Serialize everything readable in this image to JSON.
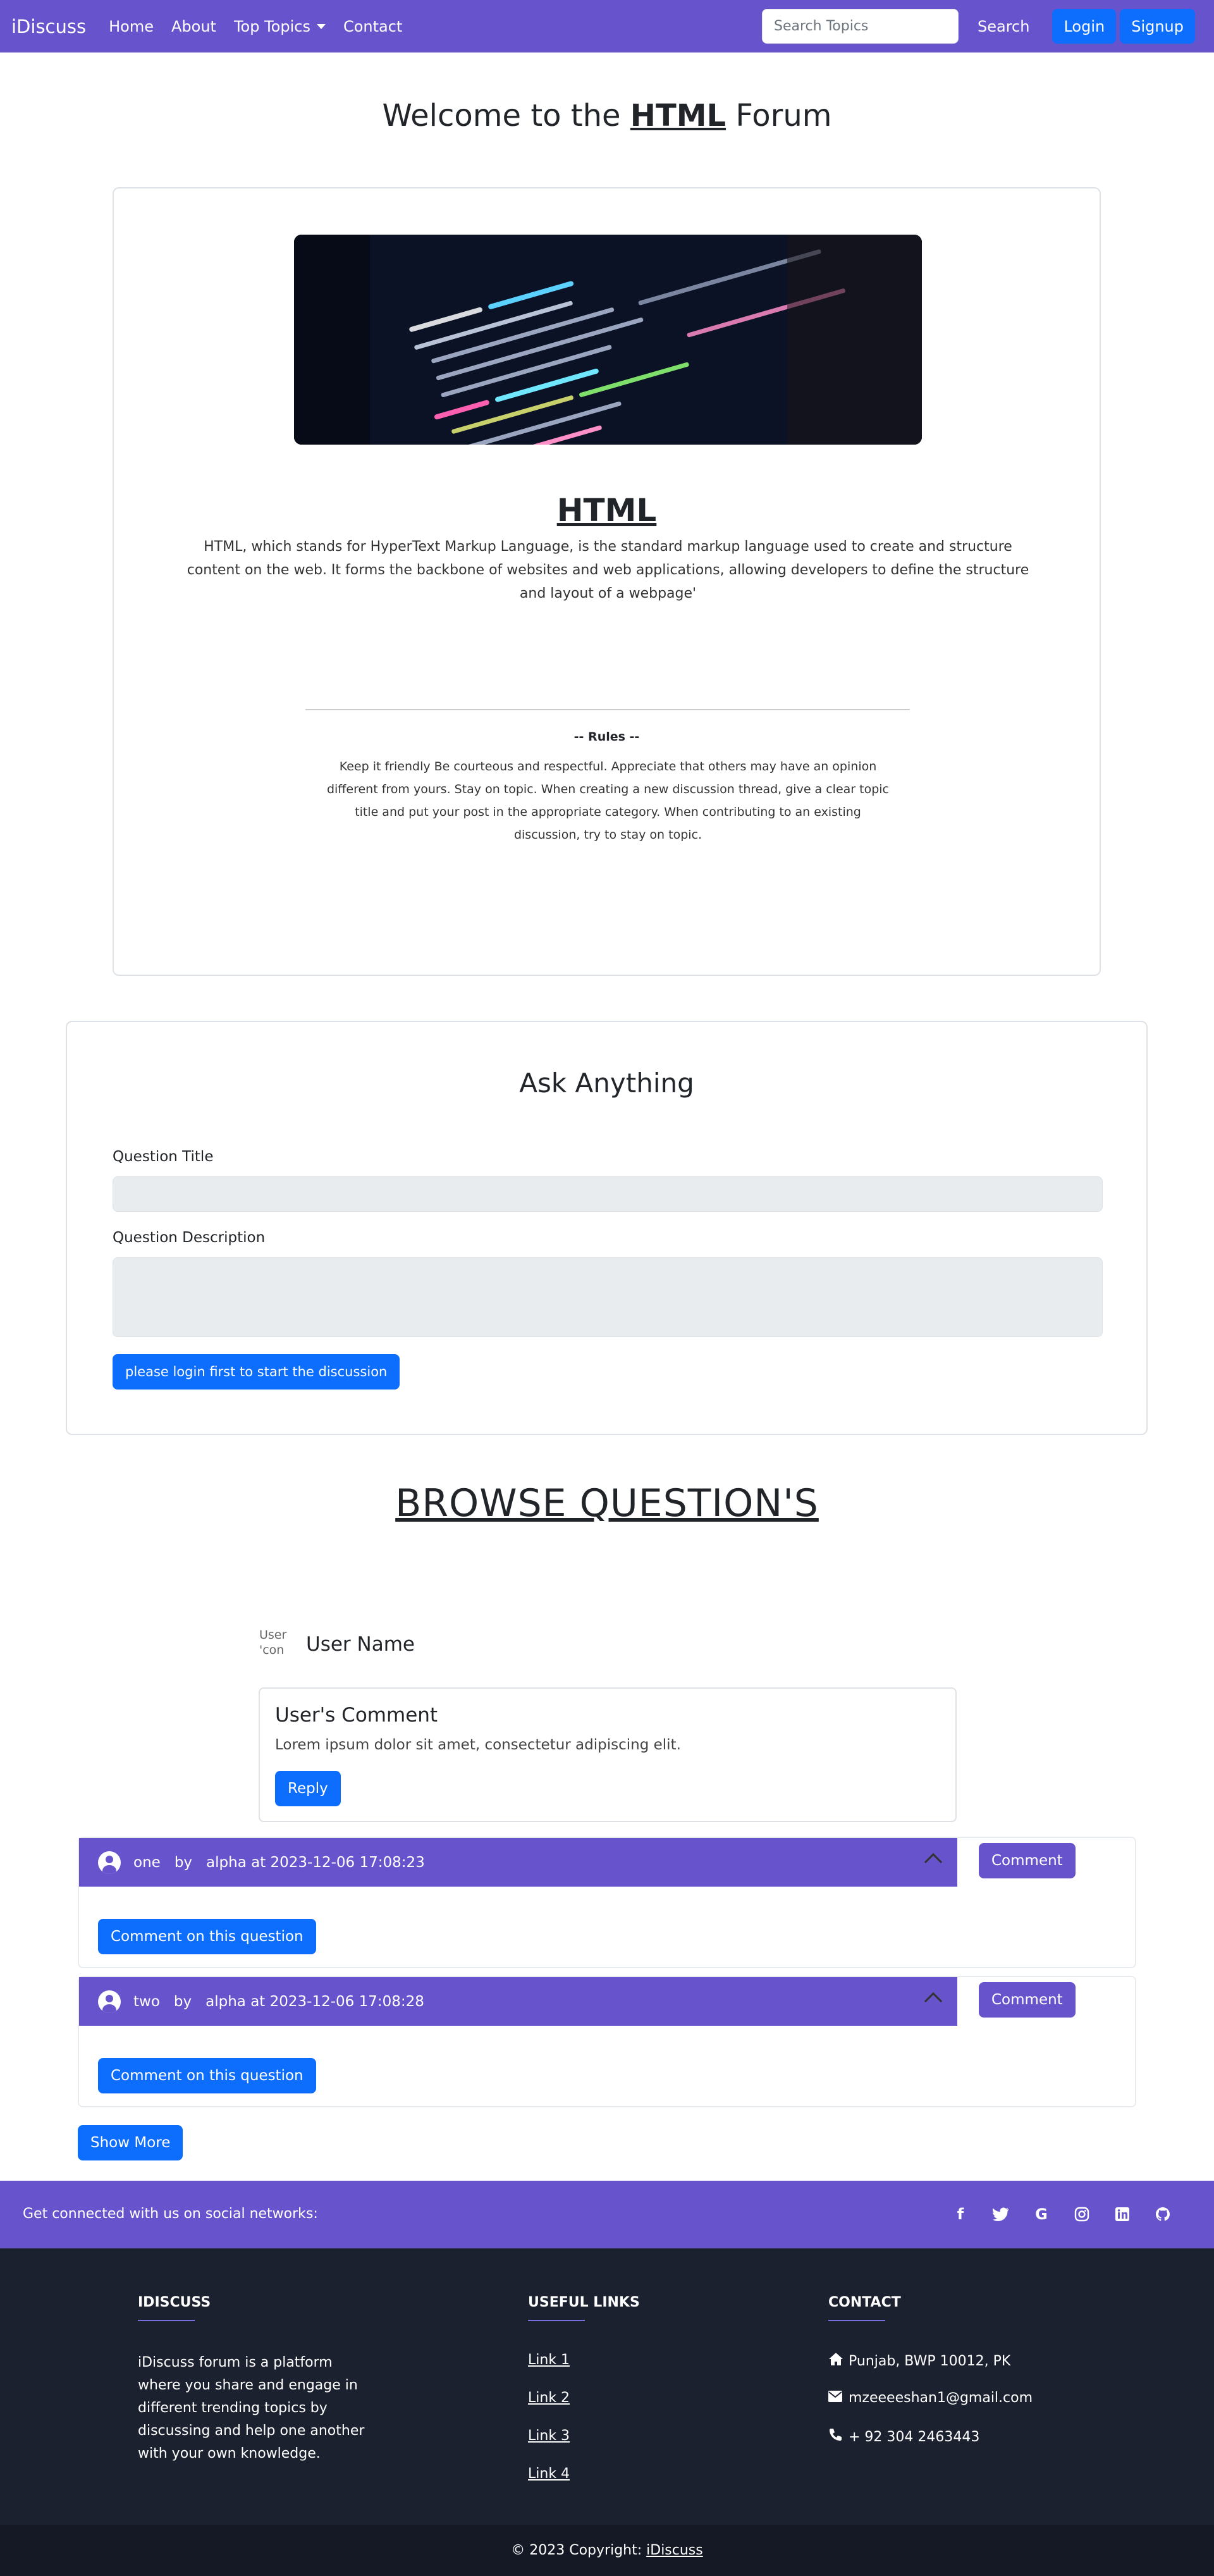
{
  "nav": {
    "brand": "iDiscuss",
    "links": [
      "Home",
      "About",
      "Top Topics",
      "Contact"
    ],
    "search_placeholder": "Search Topics",
    "search_label": "Search",
    "login_label": "Login",
    "signup_label": "Signup"
  },
  "page": {
    "title_prefix": "Welcome to the ",
    "title_topic": "HTML",
    "title_suffix": " Forum"
  },
  "category": {
    "name": "HTML",
    "description": "HTML, which stands for HyperText Markup Language, is the standard markup language used to create and structure content on the web. It forms the backbone of websites and web applications, allowing developers to define the structure and layout of a webpage'",
    "rules_title": "-- Rules --",
    "rules_text": "Keep it friendly Be courteous and respectful. Appreciate that others may have an opinion different from yours. Stay on topic. When creating a new discussion thread, give a clear topic title and put your post in the appropriate category. When contributing to an existing discussion, try to stay on topic."
  },
  "ask": {
    "title": "Ask Anything",
    "question_title_label": "Question Title",
    "question_title_value": "",
    "question_desc_label": "Question Description",
    "question_desc_value": "",
    "login_prompt": "please login first to start the discussion"
  },
  "browse": {
    "title": "BROWSE QUESTION'S",
    "sample_user": {
      "avatar_alt": "User 'con",
      "name": "User Name",
      "comment_title": "User's Comment",
      "comment_text": "Lorem ipsum dolor sit amet, consectetur adipiscing elit.",
      "reply_label": "Reply"
    },
    "questions": [
      {
        "title": "one",
        "by": "by",
        "meta": "alpha at 2023-12-06 17:08:23",
        "comment_label": "Comment",
        "comment_on_label": "Comment on this question"
      },
      {
        "title": "two",
        "by": "by",
        "meta": "alpha at 2023-12-06 17:08:28",
        "comment_label": "Comment",
        "comment_on_label": "Comment on this question"
      }
    ],
    "show_more_label": "Show More"
  },
  "footer": {
    "social_text": "Get connected with us on social networks:",
    "social_icons": [
      "facebook-icon",
      "twitter-icon",
      "google-icon",
      "instagram-icon",
      "linkedin-icon",
      "github-icon"
    ],
    "about_title": "IDISCUSS",
    "about_text": "iDiscuss forum is a platform where you share and engage in different trending topics by discussing and help one another with your own knowledge.",
    "links_title": "USEFUL LINKS",
    "links": [
      "Link 1",
      "Link 2",
      "Link 3",
      "Link 4"
    ],
    "contact_title": "CONTACT",
    "address": "Punjab, BWP 10012, PK",
    "email": "mzeeeeshan1@gmail.com",
    "phone": "+ 92 304 2463443",
    "copyright_prefix": "© 2023 Copyright: ",
    "copyright_link": "iDiscuss"
  },
  "colors": {
    "primary_purple": "#6753cc",
    "button_blue": "#0d6efd",
    "footer_dark": "#1c2130"
  }
}
